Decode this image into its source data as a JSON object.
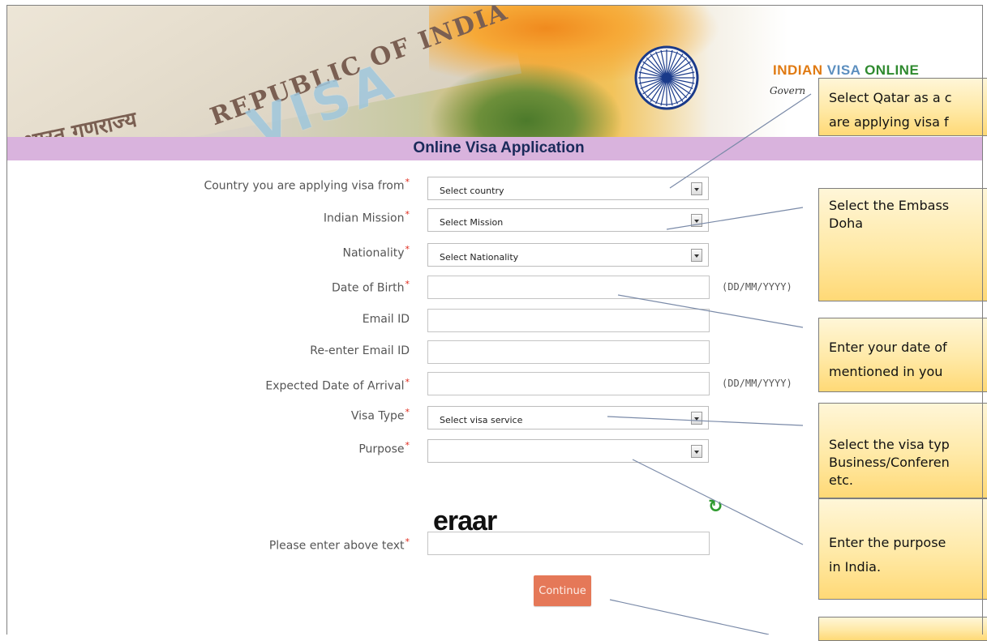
{
  "banner": {
    "republic_text": "REPUBLIC OF INDIA",
    "hindi_text": "भारत गणराज्य",
    "visa_text": "VISA",
    "brand": {
      "part1": "INDIAN",
      "part2": " VISA ",
      "part3": "ONLINE"
    },
    "brand_sub": "Govern"
  },
  "page": {
    "title": "Online Visa Application"
  },
  "form": {
    "required_mark": "*",
    "country_label": "Country you are applying visa from",
    "country_value": "Select country",
    "mission_label": "Indian Mission",
    "mission_value": "Select Mission",
    "nationality_label": "Nationality",
    "nationality_value": "Select Nationality",
    "dob_label": "Date of Birth",
    "dob_hint": "(DD/MM/YYYY)",
    "email_label": "Email ID",
    "reemail_label": "Re-enter Email ID",
    "arrival_label": "Expected Date of Arrival",
    "arrival_hint": "(DD/MM/YYYY)",
    "visa_type_label": "Visa Type",
    "visa_type_value": "Select visa service",
    "purpose_label": "Purpose",
    "purpose_value": "",
    "captcha_text": "eraar",
    "refresh_symbol": "↻",
    "captcha_label": "Please enter above text",
    "continue_label": "Continue"
  },
  "callouts": {
    "c1_line1": "Select Qatar as a c",
    "c1_line2": "are applying visa f",
    "c2_line1": "Select the Embass",
    "c2_line2": "Doha",
    "c3_line1": "Enter your date of",
    "c3_line2": "mentioned in you",
    "c4_line1": "Select the visa typ",
    "c4_line2": "Business/Conferen",
    "c4_line3": "etc.",
    "c5_line1": "Enter the purpose",
    "c5_line2": "in India."
  },
  "colors": {
    "title_bar": "#d9b3dd",
    "continue_button": "#e57858",
    "required": "#e0281a",
    "callout_fill": "#ffe9a6"
  }
}
